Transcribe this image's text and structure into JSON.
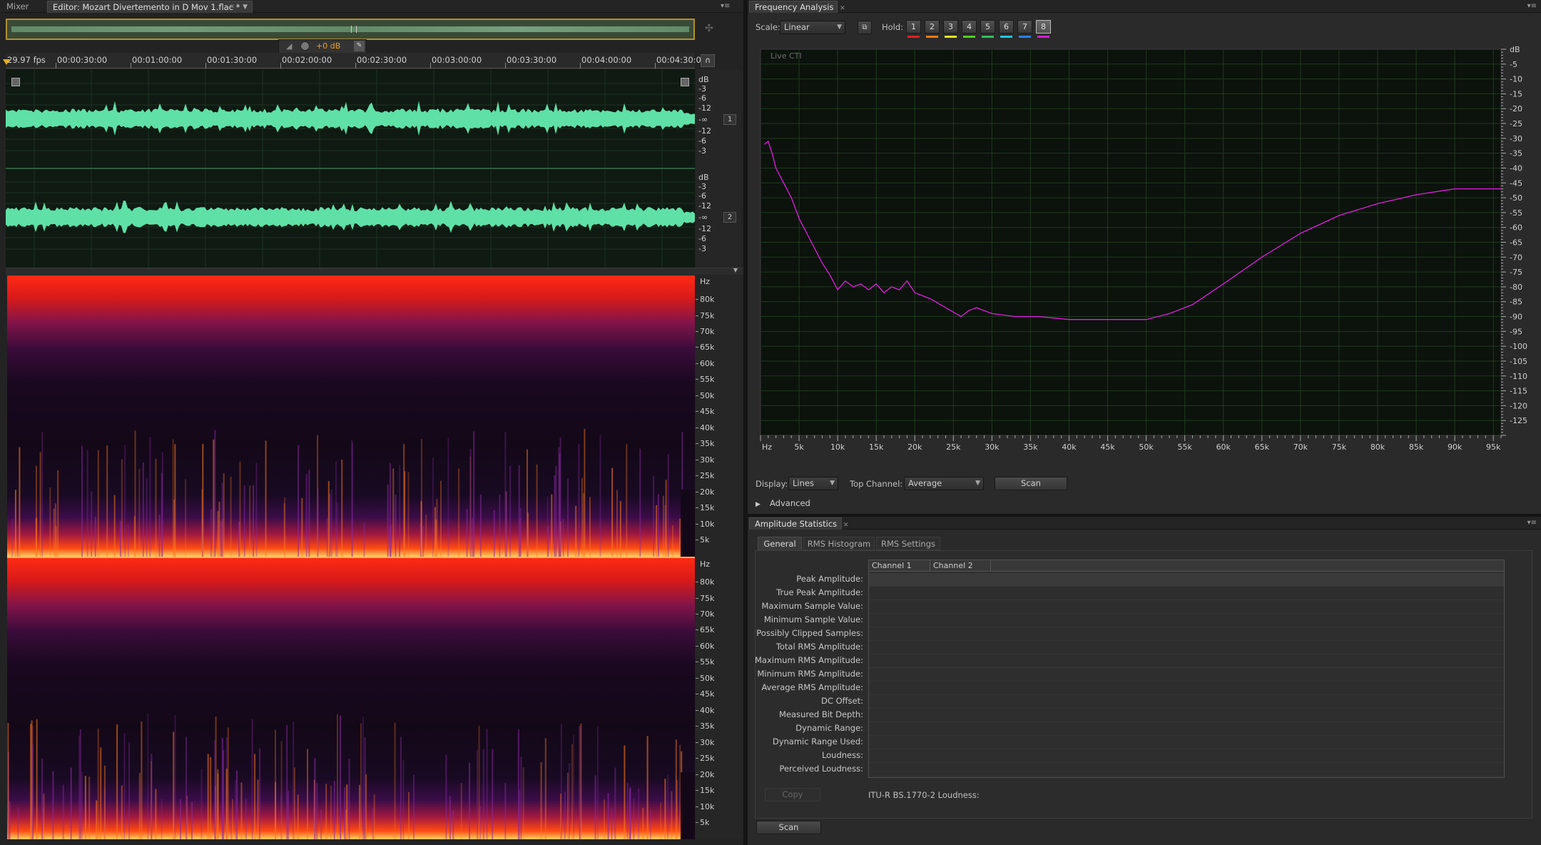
{
  "editor": {
    "tabs": [
      {
        "label": "Mixer"
      },
      {
        "label": "Editor: Mozart Divertemento in D Mov 1.flac *"
      }
    ],
    "fps": "29.97 fps",
    "hud_gain": "+0 dB",
    "timecodes": [
      "00:00:30:00",
      "00:01:00:00",
      "00:01:30:00",
      "00:02:00:00",
      "00:02:30:00",
      "00:03:00:00",
      "00:03:30:00",
      "00:04:00:00",
      "00:04:30:0"
    ],
    "db_unit": "dB",
    "db_ticks": [
      "-3",
      "-6",
      "-12",
      "-∞",
      "-12",
      "-6",
      "-3"
    ],
    "channel_badges": [
      "1",
      "2"
    ],
    "hz_unit": "Hz",
    "hz_ticks": [
      "80k",
      "75k",
      "70k",
      "65k",
      "60k",
      "55k",
      "50k",
      "45k",
      "40k",
      "35k",
      "30k",
      "25k",
      "20k",
      "15k",
      "10k",
      "5k"
    ],
    "colors": {
      "waveform": "#5fe0a6",
      "spectral_hot": "#ff2a10",
      "spectral_cold": "#130818"
    }
  },
  "freq": {
    "tab_label": "Frequency Analysis",
    "scale_label": "Scale:",
    "scale_value": "Linear",
    "hold_label": "Hold:",
    "hold_buttons": [
      "1",
      "2",
      "3",
      "4",
      "5",
      "6",
      "7",
      "8"
    ],
    "hold_colors": [
      "#e02020",
      "#f07a10",
      "#e8e820",
      "#50d020",
      "#30c060",
      "#20c8e0",
      "#2a80ff",
      "#d020d0"
    ],
    "live_label": "Live CTI",
    "display_label": "Display:",
    "display_value": "Lines",
    "top_channel_label": "Top Channel:",
    "top_channel_value": "Average",
    "scan_label": "Scan",
    "advanced_label": "Advanced"
  },
  "chart_data": {
    "type": "line",
    "title": "",
    "xlabel": "Hz",
    "ylabel": "dB",
    "xlim": [
      0,
      96000
    ],
    "ylim": [
      -130,
      0
    ],
    "x_ticks": [
      "Hz",
      "5k",
      "10k",
      "15k",
      "20k",
      "25k",
      "30k",
      "35k",
      "40k",
      "45k",
      "50k",
      "55k",
      "60k",
      "65k",
      "70k",
      "75k",
      "80k",
      "85k",
      "90k",
      "95k"
    ],
    "y_ticks": [
      "dB",
      "-5",
      "-10",
      "-15",
      "-20",
      "-25",
      "-30",
      "-35",
      "-40",
      "-45",
      "-50",
      "-55",
      "-60",
      "-65",
      "-70",
      "-75",
      "-80",
      "-85",
      "-90",
      "-95",
      "-100",
      "-105",
      "-110",
      "-115",
      "-120",
      "-125"
    ],
    "grid": true,
    "series": [
      {
        "color": "#e020e0",
        "x": [
          500,
          1000,
          1500,
          2000,
          3000,
          4000,
          5000,
          6000,
          7000,
          8000,
          9000,
          10000,
          11000,
          12000,
          13000,
          14000,
          15000,
          16000,
          17000,
          18000,
          19000,
          20000,
          22000,
          24000,
          26000,
          27000,
          28000,
          30000,
          33000,
          36000,
          40000,
          45000,
          50000,
          53000,
          56000,
          60000,
          65000,
          70000,
          75000,
          80000,
          85000,
          90000,
          96000
        ],
        "y": [
          -32,
          -31,
          -35,
          -40,
          -45,
          -50,
          -57,
          -62,
          -67,
          -72,
          -76,
          -81,
          -78,
          -80,
          -79,
          -81,
          -79,
          -82,
          -80,
          -81,
          -78,
          -82,
          -84,
          -87,
          -90,
          -88,
          -87,
          -89,
          -90,
          -90,
          -91,
          -91,
          -91,
          -89,
          -86,
          -79,
          -70,
          -62,
          -56,
          -52,
          -49,
          -47,
          -47
        ]
      }
    ]
  },
  "amp": {
    "tab_label": "Amplitude Statistics",
    "subtabs": [
      "General",
      "RMS Histogram",
      "RMS Settings"
    ],
    "col_headers": [
      "Channel 1",
      "Channel 2"
    ],
    "rows": [
      "Peak Amplitude:",
      "True Peak Amplitude:",
      "Maximum Sample Value:",
      "Minimum Sample Value:",
      "Possibly Clipped Samples:",
      "Total RMS Amplitude:",
      "Maximum RMS Amplitude:",
      "Minimum RMS Amplitude:",
      "Average RMS Amplitude:",
      "DC Offset:",
      "Measured Bit Depth:",
      "Dynamic Range:",
      "Dynamic Range Used:",
      "Loudness:",
      "Perceived Loudness:"
    ],
    "copy_label": "Copy",
    "itu_label": "ITU-R BS.1770-2 Loudness:",
    "scan_label": "Scan"
  }
}
